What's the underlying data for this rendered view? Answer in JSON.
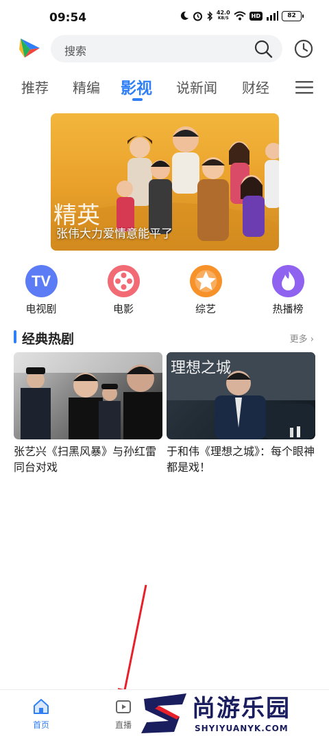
{
  "status_bar": {
    "time": "09:54",
    "net_speed_value": "42.0",
    "net_speed_unit": "KB/S",
    "hd": "HD",
    "battery": "82"
  },
  "search": {
    "placeholder": "搜索"
  },
  "tabs": [
    {
      "label": "推荐",
      "active": false
    },
    {
      "label": "精编",
      "active": false
    },
    {
      "label": "影视",
      "active": true
    },
    {
      "label": "说新闻",
      "active": false
    },
    {
      "label": "财经",
      "active": false
    }
  ],
  "banner": {
    "poster_title": "精英",
    "caption": "张伟大力爱情意能平了"
  },
  "categories": [
    {
      "label": "电视剧",
      "icon": "tv-icon",
      "color": "#5b7cf5"
    },
    {
      "label": "电影",
      "icon": "film-reel-icon",
      "color": "#f26b74"
    },
    {
      "label": "综艺",
      "icon": "star-icon",
      "color": "#f7922a"
    },
    {
      "label": "热播榜",
      "icon": "flame-icon",
      "color": "#8f62f0"
    }
  ],
  "section": {
    "title": "经典热剧",
    "more": "更多"
  },
  "cards": [
    {
      "title": "张艺兴《扫黑风暴》与孙红雷同台对戏"
    },
    {
      "title": "于和伟《理想之城》：每个眼神都是戏！",
      "poster_title": "理想之城"
    }
  ],
  "bottom_nav": [
    {
      "label": "首页",
      "icon": "home-icon",
      "active": true
    },
    {
      "label": "直播",
      "icon": "live-icon",
      "active": false
    }
  ],
  "watermark": {
    "brand": "尚游乐园",
    "domain": "SHYIYUANYK.COM"
  },
  "colors": {
    "accent": "#2f7ff6",
    "arrow": "#e8202a"
  }
}
